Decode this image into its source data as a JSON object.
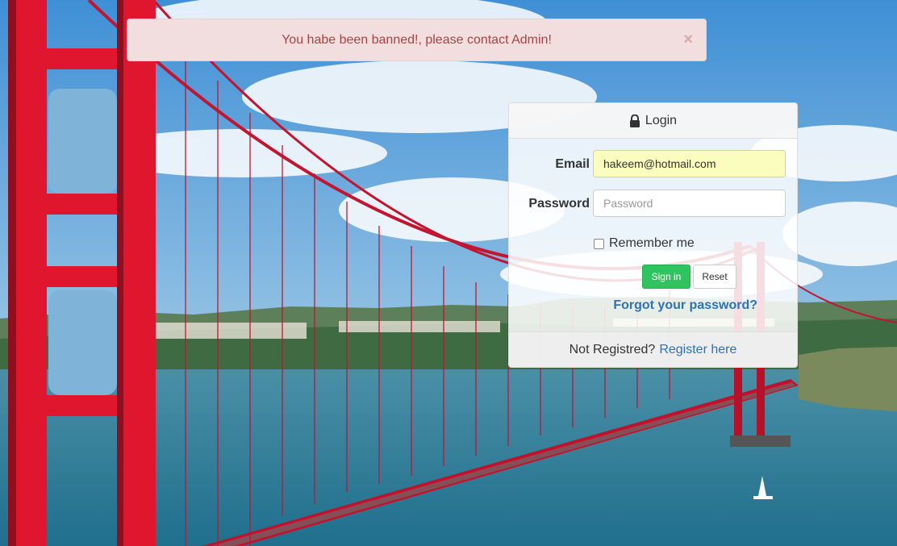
{
  "alert": {
    "message": "You habe been banned!, please contact Admin!",
    "close_symbol": "×",
    "color": "#a94442",
    "background": "#f2dede"
  },
  "login": {
    "title": "Login",
    "title_icon": "lock-icon",
    "email_label": "Email",
    "email_value": "hakeem@hotmail.com",
    "password_label": "Password",
    "password_placeholder": "Password",
    "remember_label": "Remember me",
    "remember_checked": false,
    "sign_in_label": "Sign in",
    "reset_label": "Reset",
    "forgot_label": "Forgot your password?",
    "footer_text": "Not Registred?",
    "register_label": "Register here"
  },
  "colors": {
    "success": "#2fc45f",
    "link": "#2a73b5"
  }
}
